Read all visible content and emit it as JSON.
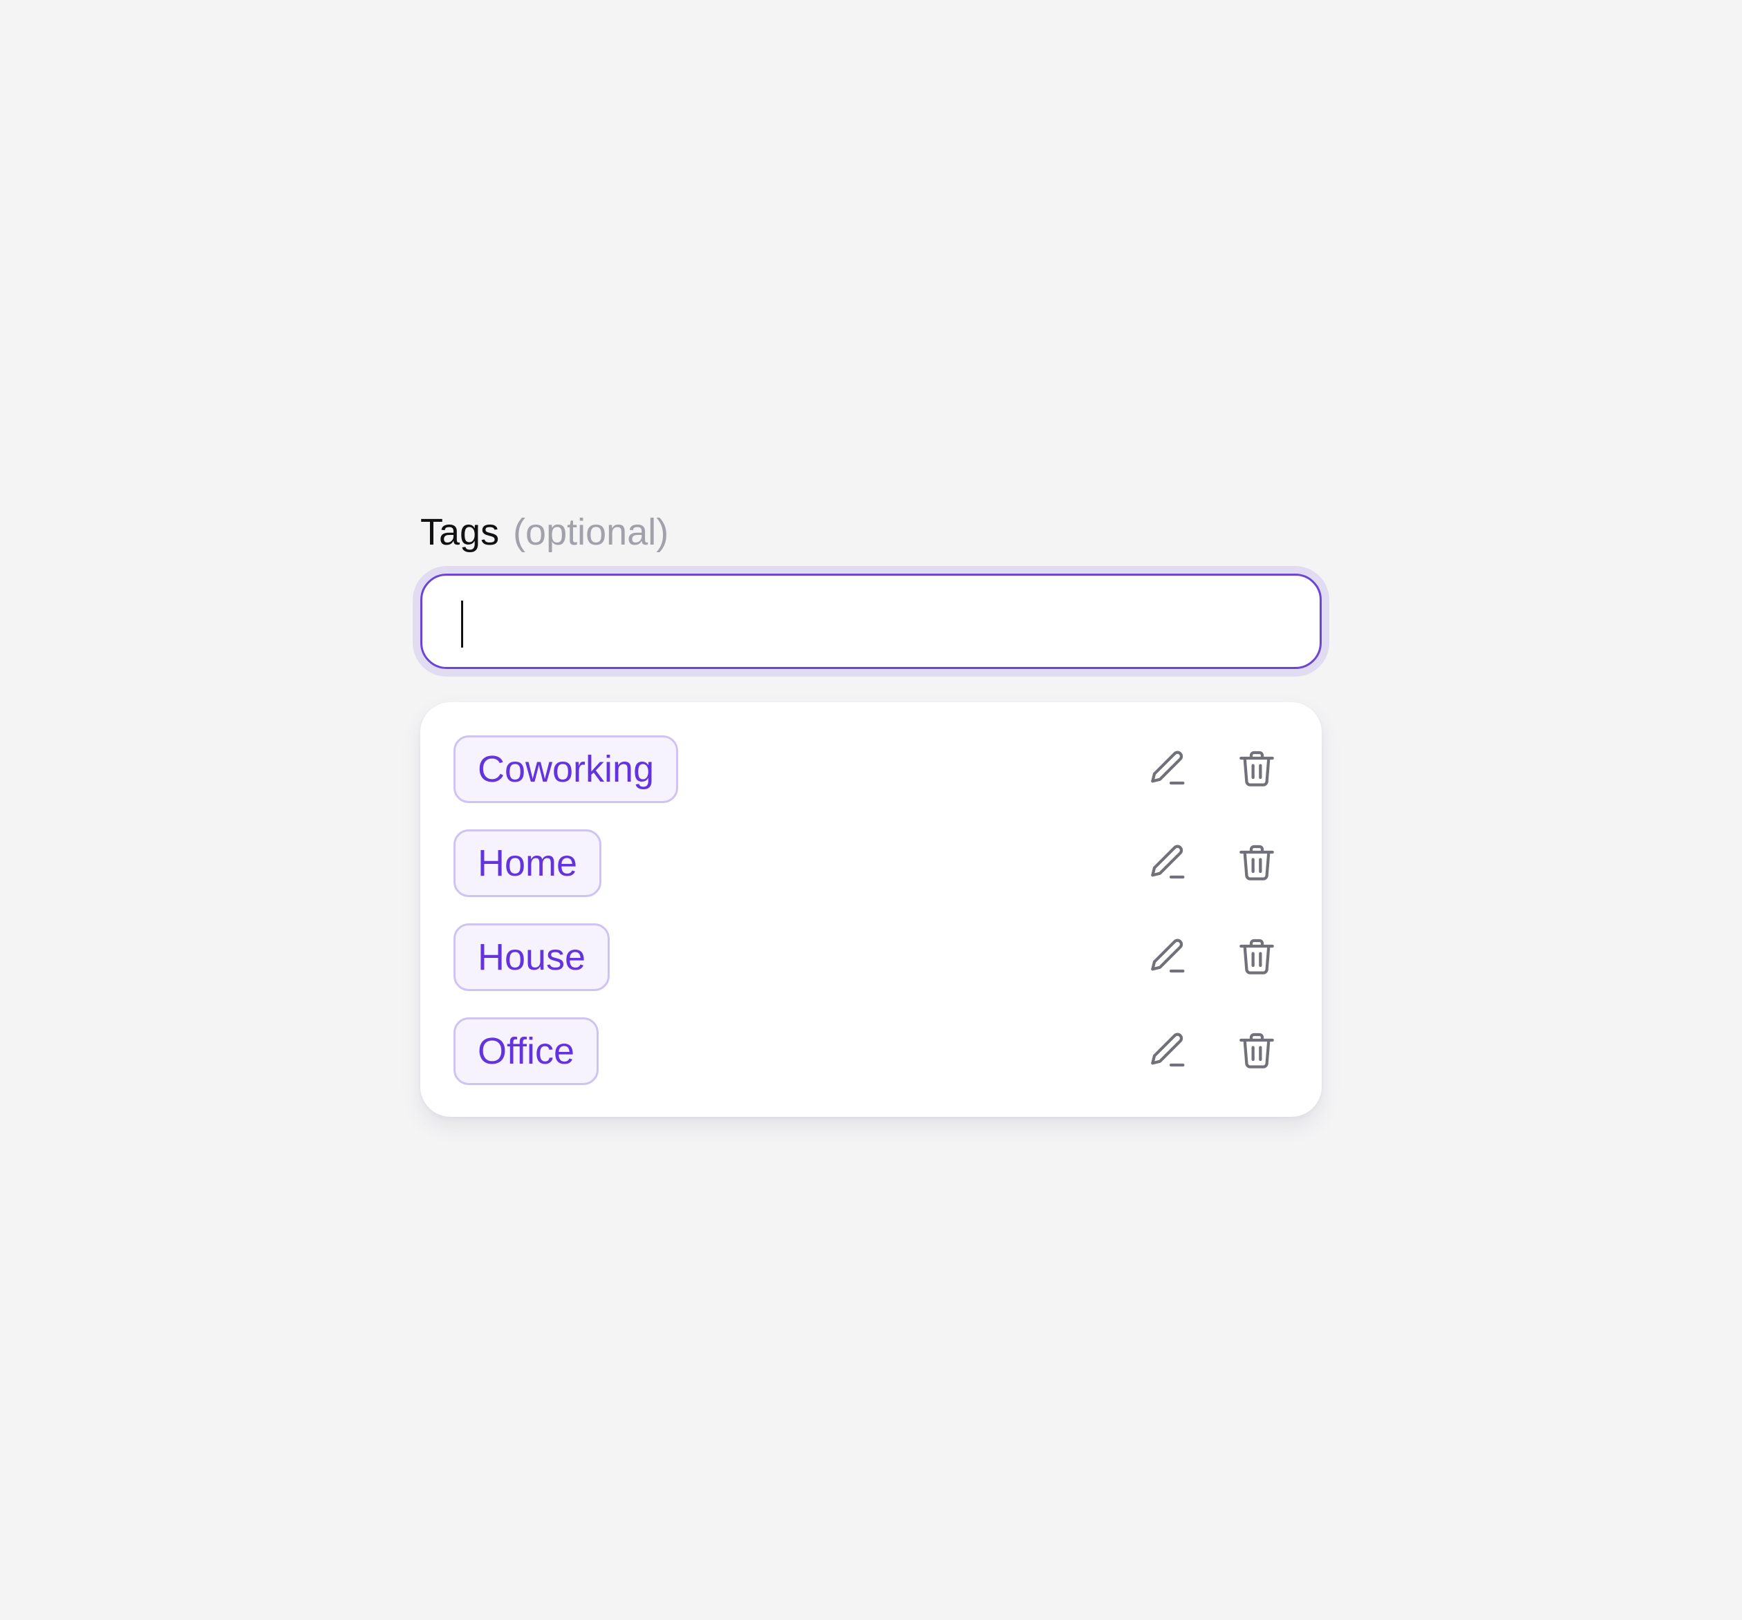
{
  "field": {
    "label": "Tags",
    "optional_label": "(optional)",
    "input_value": "",
    "input_placeholder": ""
  },
  "tags": [
    {
      "label": "Coworking",
      "edit_icon": "pencil-icon",
      "delete_icon": "trash-icon"
    },
    {
      "label": "Home",
      "edit_icon": "pencil-icon",
      "delete_icon": "trash-icon"
    },
    {
      "label": "House",
      "edit_icon": "pencil-icon",
      "delete_icon": "trash-icon"
    },
    {
      "label": "Office",
      "edit_icon": "pencil-icon",
      "delete_icon": "trash-icon"
    }
  ],
  "colors": {
    "accent": "#6d44d8",
    "chip_text": "#6333dd",
    "chip_bg": "#f6f3fe",
    "chip_border": "#cfc3f3",
    "icon": "#71717a",
    "background": "#f4f4f5"
  }
}
